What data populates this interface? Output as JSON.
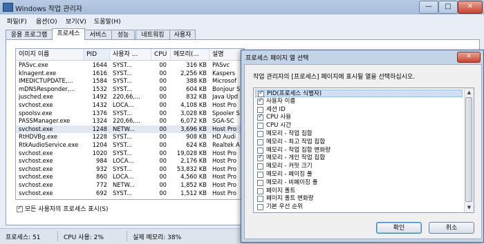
{
  "window": {
    "title": "Windows 작업 관리자"
  },
  "titlebar_buttons": {
    "minimize": "—",
    "maximize": "□",
    "close": "✕"
  },
  "menu": [
    "파일(F)",
    "옵션(O)",
    "보기(V)",
    "도움말(H)"
  ],
  "tabs": [
    "응용 프로그램",
    "프로세스",
    "서비스",
    "성능",
    "네트워킹",
    "사용자"
  ],
  "active_tab": "프로세스",
  "process_table": {
    "columns": [
      "이미지 이름",
      "PID",
      "사용자 ...",
      "CPU",
      "메모리(...",
      "설명"
    ],
    "rows": [
      [
        "PASvc.exe",
        "1644",
        "SYST...",
        "00",
        "316 KB",
        "PASvc"
      ],
      [
        "klnagent.exe",
        "1616",
        "SYST...",
        "00",
        "2,256 KB",
        "Kaspers"
      ],
      [
        "IMEDICTUPDATE,...",
        "1584",
        "SYST...",
        "00",
        "388 KB",
        "Microsof"
      ],
      [
        "mDNSResponder,...",
        "1532",
        "SYST...",
        "00",
        "604 KB",
        "Bonjour S"
      ],
      [
        "jusched.exe",
        "1492",
        "220,66,...",
        "00",
        "832 KB",
        "Java Upd"
      ],
      [
        "svchost.exe",
        "1432",
        "LOCA...",
        "00",
        "4,108 KB",
        "Host Pro"
      ],
      [
        "spoolsv.exe",
        "1376",
        "SYST...",
        "00",
        "3,028 KB",
        "Spooler S"
      ],
      [
        "PASSManager.exe",
        "1324",
        "220,66,...",
        "00",
        "6,072 KB",
        "SGA-SC"
      ],
      [
        "svchost.exe",
        "1248",
        "NETW...",
        "00",
        "3,696 KB",
        "Host Pro"
      ],
      [
        "RtHDVBg.exe",
        "1228",
        "SYST...",
        "00",
        "908 KB",
        "HD Audi"
      ],
      [
        "RtkAudioService.exe",
        "1204",
        "SYST...",
        "00",
        "624 KB",
        "Realtek A"
      ],
      [
        "svchost.exe",
        "1020",
        "SYST...",
        "00",
        "19,028 KB",
        "Host Pro"
      ],
      [
        "svchost.exe",
        "984",
        "LOCA...",
        "00",
        "2,176 KB",
        "Host Pro"
      ],
      [
        "svchost.exe",
        "932",
        "SYST...",
        "00",
        "53,832 KB",
        "Host Pro"
      ],
      [
        "svchost.exe",
        "860",
        "LOCA...",
        "00",
        "4,560 KB",
        "Host Pro"
      ],
      [
        "svchost.exe",
        "772",
        "NETW...",
        "00",
        "1,852 KB",
        "Host Pro"
      ],
      [
        "svchost.exe",
        "692",
        "SYST...",
        "00",
        "1,512 KB",
        "Host Pro"
      ]
    ],
    "selected_row": 8
  },
  "show_all_processes": {
    "label": "모든 사용자의 프로세스 표시(S)",
    "checked": true
  },
  "statusbar": {
    "processes": "프로세스: 51",
    "cpu": "CPU 사용: 2%",
    "memory": "실제 메모리: 38%"
  },
  "dialog": {
    "title": "프로세스 페이지 열 선택",
    "close": "✕",
    "instruction": "작업 관리자의 [프로세스] 페이지에 표시될 열을 선택하십시오.",
    "columns": [
      {
        "label": "PID(프로세스 식별자)",
        "checked": true
      },
      {
        "label": "사용자 이름",
        "checked": true
      },
      {
        "label": "세션 ID",
        "checked": false
      },
      {
        "label": "CPU 사용",
        "checked": true
      },
      {
        "label": "CPU 시간",
        "checked": false
      },
      {
        "label": "메모리 - 작업 집합",
        "checked": false
      },
      {
        "label": "메모리 - 최고 작업 집합",
        "checked": false
      },
      {
        "label": "메모리 - 작업 집합 변화량",
        "checked": false
      },
      {
        "label": "메모리 - 개인 작업 집합",
        "checked": true
      },
      {
        "label": "메모리 - 커밋 크기",
        "checked": false
      },
      {
        "label": "메모리 - 페이징 풀",
        "checked": false
      },
      {
        "label": "메모리 - 비페이징 풀",
        "checked": false
      },
      {
        "label": "페이지 폴트",
        "checked": false
      },
      {
        "label": "페이지 폴트 변화량",
        "checked": false
      },
      {
        "label": "기본 우선 순위",
        "checked": false
      }
    ],
    "ok": "확인",
    "cancel": "취소"
  }
}
